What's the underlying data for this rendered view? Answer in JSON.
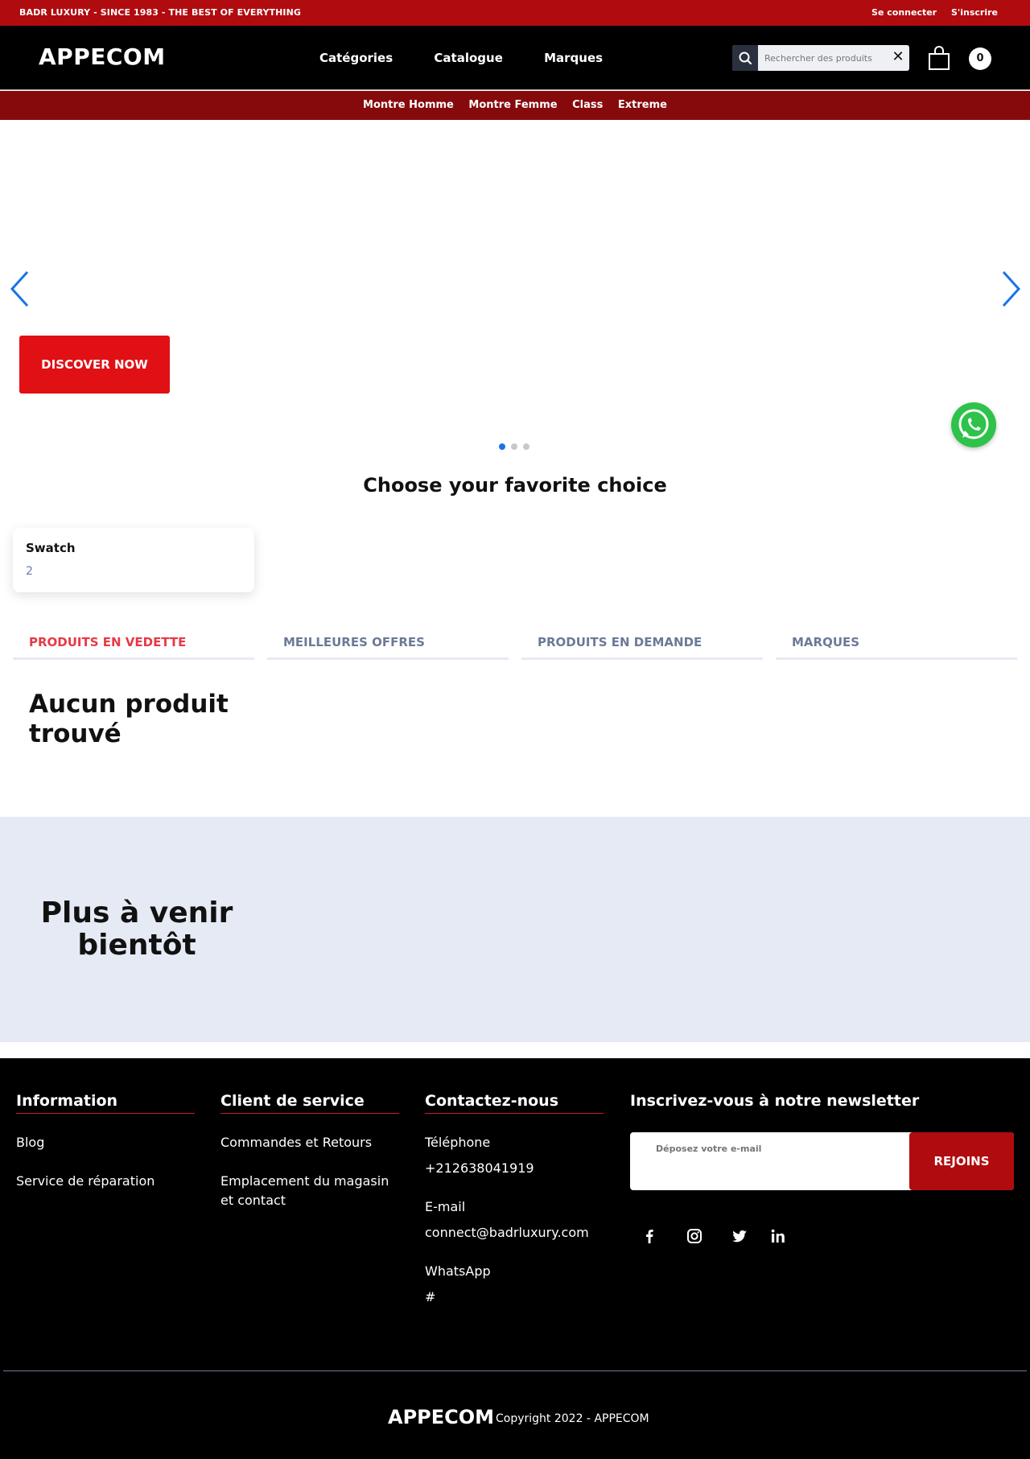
{
  "topbar": {
    "tagline": "BADR LUXURY - SINCE 1983 - THE BEST OF EVERYTHING",
    "login": "Se connecter",
    "signup": "S'inscrire"
  },
  "header": {
    "logo": "APPECOM",
    "nav": [
      "Catégories",
      "Catalogue",
      "Marques"
    ],
    "search_placeholder": "Rechercher des produits",
    "cart_count": "0"
  },
  "subnav": [
    "Montre Homme",
    "Montre Femme",
    "Class",
    "Extreme"
  ],
  "hero": {
    "cta": "DISCOVER NOW",
    "slides": 3,
    "active_slide": 1
  },
  "choice": {
    "title": "Choose your favorite choice",
    "brands": [
      {
        "name": "Swatch",
        "count": "2"
      }
    ]
  },
  "tabs": [
    "PRODUITS EN VEDETTE",
    "MEILLEURES OFFRES",
    "PRODUITS EN DEMANDE",
    "MARQUES"
  ],
  "empty_message": "Aucun produit trouvé",
  "soon": "Plus à venir bientôt",
  "footer": {
    "info": {
      "title": "Information",
      "links": [
        "Blog",
        "Service de réparation"
      ]
    },
    "service": {
      "title": "Client de service",
      "links": [
        "Commandes et Retours",
        "Emplacement du magasin et contact"
      ]
    },
    "contact": {
      "title": "Contactez-nous",
      "phone_label": "Téléphone",
      "phone": "+212638041919",
      "email_label": "E-mail",
      "email": "connect@badrluxury.com",
      "whatsapp_label": "WhatsApp",
      "whatsapp": "#"
    },
    "newsletter": {
      "title": "Inscrivez-vous à notre newsletter",
      "placeholder": "Déposez votre e-mail",
      "button": "REJOINS"
    },
    "socials": [
      "facebook-icon",
      "instagram-icon",
      "twitter-icon",
      "linkedin-icon"
    ],
    "logo": "APPECOM",
    "copyright": "Copyright 2022 - APPECOM"
  },
  "colors": {
    "brand_red": "#b00b0f",
    "cta_red": "#e01015",
    "accent_blue": "#1a73e8",
    "tab_active": "#e63946"
  }
}
